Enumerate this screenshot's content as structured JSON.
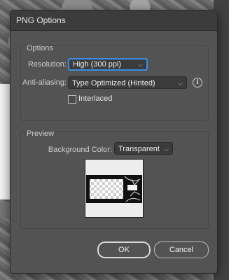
{
  "dialog": {
    "title": "PNG Options"
  },
  "options": {
    "group_label": "Options",
    "resolution_label": "Resolution:",
    "resolution_value": "High (300 ppi)",
    "antialias_label": "Anti-aliasing:",
    "antialias_value": "Type Optimized (Hinted)",
    "interlaced_label": "Interlaced",
    "interlaced_checked": false
  },
  "preview": {
    "group_label": "Preview",
    "bg_color_label": "Background Color:",
    "bg_color_value": "Transparent"
  },
  "buttons": {
    "ok": "OK",
    "cancel": "Cancel"
  },
  "icons": {
    "info": "info-icon",
    "chevron": "chevron-down-icon"
  },
  "colors": {
    "focus": "#3a8ee6",
    "dialog_bg": "#535353",
    "titlebar_bg": "#3c3c3c"
  }
}
